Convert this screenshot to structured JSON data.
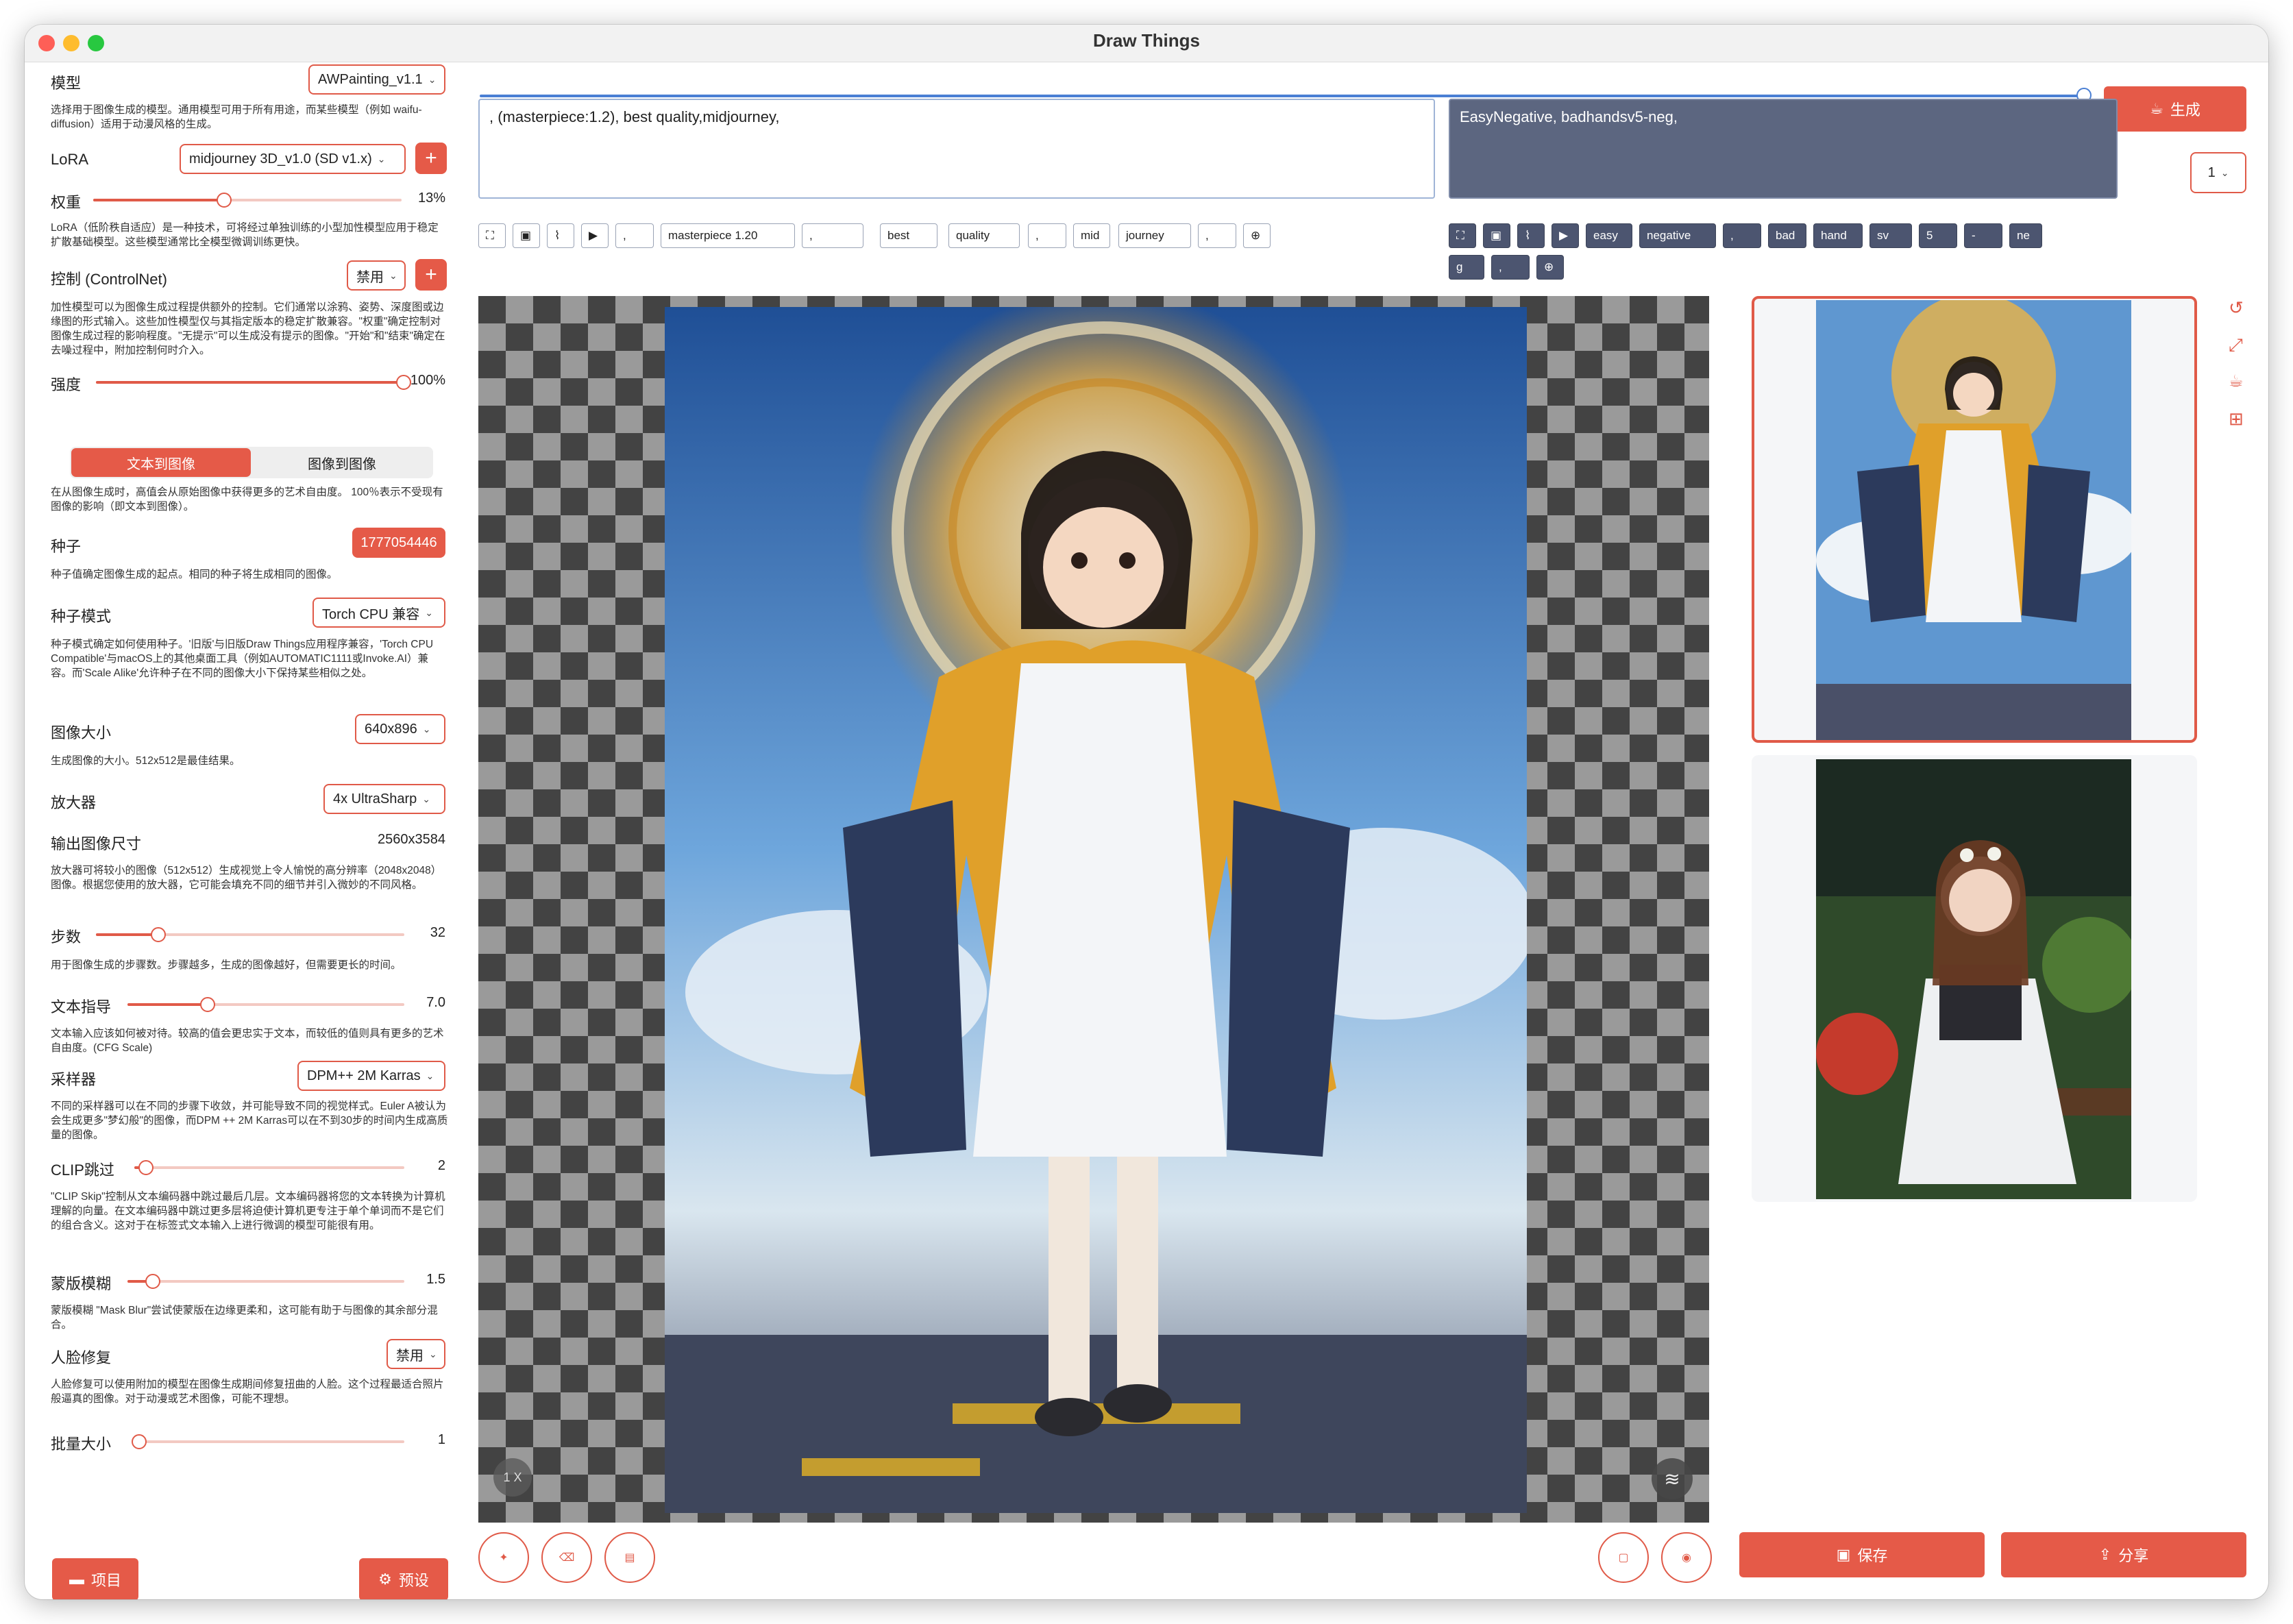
{
  "window": {
    "title": "Draw Things"
  },
  "colors": {
    "accent": "#e55a48",
    "negative_bg": "#5c6680",
    "prompt_border": "#9fb4d6"
  },
  "left": {
    "model": {
      "label": "模型",
      "value": "AWPainting_v1.1",
      "desc": "选择用于图像生成的模型。通用模型可用于所有用途，而某些模型（例如 waifu-diffusion）适用于动漫风格的生成。"
    },
    "lora": {
      "label": "LoRA",
      "value": "midjourney 3D_v1.0 (SD v1.x)"
    },
    "weight": {
      "label": "权重",
      "value": "13%",
      "level": 0.13,
      "desc": "LoRA（低阶秩自适应）是一种技术，可将经过单独训练的小型加性模型应用于稳定扩散基础模型。这些模型通常比全模型微调训练更快。"
    },
    "controlnet": {
      "label": "控制 (ControlNet)",
      "value": "禁用",
      "desc": "加性模型可以为图像生成过程提供额外的控制。它们通常以涂鸦、姿势、深度图或边缘图的形式输入。这些加性模型仅与其指定版本的稳定扩散兼容。\"权重\"确定控制对图像生成过程的影响程度。\"无提示\"可以生成没有提示的图像。\"开始\"和\"结束\"确定在去噪过程中，附加控制何时介入。"
    },
    "strength": {
      "label": "强度",
      "value": "100%",
      "level": 1.0
    },
    "mode_tabs": [
      "文本到图像",
      "图像到图像"
    ],
    "strength_desc": "在从图像生成时，高值会从原始图像中获得更多的艺术自由度。 100％表示不受现有图像的影响（即文本到图像）。",
    "seed": {
      "label": "种子",
      "value": "1777054446",
      "desc": "种子值确定图像生成的起点。相同的种子将生成相同的图像。"
    },
    "seed_mode": {
      "label": "种子模式",
      "value": "Torch CPU 兼容",
      "desc": "种子模式确定如何使用种子。'旧版'与旧版Draw Things应用程序兼容，'Torch CPU Compatible'与macOS上的其他桌面工具（例如AUTOMATIC1111或Invoke.AI）兼容。而'Scale Alike'允许种子在不同的图像大小下保持某些相似之处。"
    },
    "image_size": {
      "label": "图像大小",
      "value": "640x896",
      "desc": "生成图像的大小。512x512是最佳结果。"
    },
    "upscaler": {
      "label": "放大器",
      "value": "4x UltraSharp"
    },
    "output_size": {
      "label": "输出图像尺寸",
      "value": "2560x3584",
      "desc": "放大器可将较小的图像（512x512）生成视觉上令人愉悦的高分辨率（2048x2048）图像。根据您使用的放大器，它可能会填充不同的细节并引入微妙的不同风格。"
    },
    "steps": {
      "label": "步数",
      "value": "32",
      "level": 0.32,
      "desc": "用于图像生成的步骤数。步骤越多，生成的图像越好，但需要更长的时间。"
    },
    "guidance": {
      "label": "文本指导",
      "value": "7.0",
      "level": 0.28,
      "desc": "文本输入应该如何被对待。较高的值会更忠实于文本，而较低的值则具有更多的艺术自由度。(CFG Scale)"
    },
    "sampler": {
      "label": "采样器",
      "value": "DPM++ 2M Karras",
      "desc": "不同的采样器可以在不同的步骤下收敛，并可能导致不同的视觉样式。Euler A被认为会生成更多\"梦幻般\"的图像，而DPM ++ 2M Karras可以在不到30步的时间内生成高质量的图像。"
    },
    "clip_skip": {
      "label": "CLIP跳过",
      "value": "2",
      "level": 0.04,
      "desc": "\"CLIP Skip\"控制从文本编码器中跳过最后几层。文本编码器将您的文本转换为计算机理解的向量。在文本编码器中跳过更多层将迫使计算机更专注于单个单词而不是它们的组合含义。这对于在标签式文本输入上进行微调的模型可能很有用。"
    },
    "mask_blur": {
      "label": "蒙版模糊",
      "value": "1.5",
      "level": 0.09,
      "desc": "蒙版模糊 \"Mask Blur\"尝试使蒙版在边缘更柔和，这可能有助于与图像的其余部分混合。"
    },
    "face_restore": {
      "label": "人脸修复",
      "value": "禁用",
      "desc": "人脸修复可以使用附加的模型在图像生成期间修复扭曲的人脸。这个过程最适合照片般逼真的图像。对于动漫或艺术图像，可能不理想。"
    },
    "batch_size": {
      "label": "批量大小",
      "value": "1",
      "level": 0.0
    },
    "project_button": "项目",
    "preset_button": "预设"
  },
  "prompt": {
    "positive": ", (masterpiece:1.2), best quality,midjourney,",
    "negative": "EasyNegative, badhandsv5-neg,",
    "pos_tokens": [
      ",",
      "masterpiece",
      "1.20",
      ",",
      "best",
      "quality",
      ",",
      "mid",
      "journey",
      ","
    ],
    "neg_tokens": [
      "easy",
      "negative",
      ",",
      "bad",
      "hand",
      "sv",
      "5",
      "-",
      "ne",
      "g",
      ","
    ]
  },
  "generate_button": "生成",
  "count_select": "1",
  "canvas": {
    "zoom_label": "1 X"
  },
  "right": {
    "save_button": "保存",
    "share_button": "分享"
  }
}
